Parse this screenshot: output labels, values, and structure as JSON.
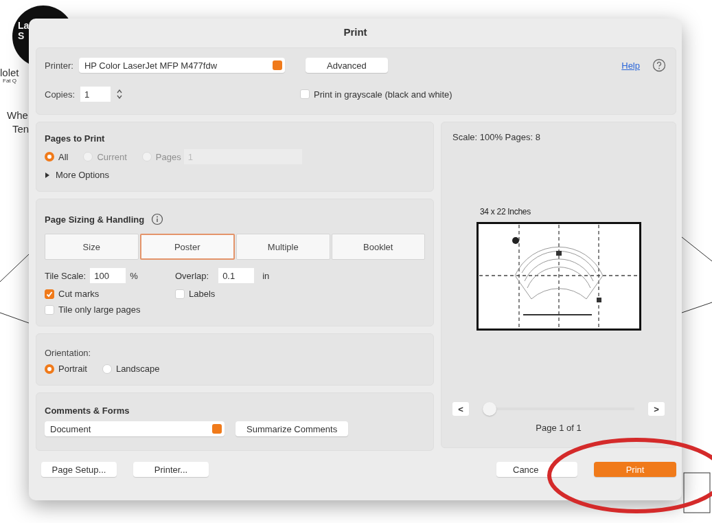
{
  "background": {
    "logo_lines": [
      "La",
      "S"
    ],
    "fragments": [
      "lolet",
      "Fat Q",
      "Whe",
      "Ten"
    ]
  },
  "window": {
    "title": "Print"
  },
  "printer": {
    "label": "Printer:",
    "value": "HP Color LaserJet MFP M477fdw",
    "advanced_button": "Advanced",
    "help_link": "Help"
  },
  "copies": {
    "label": "Copies:",
    "value": "1"
  },
  "grayscale": {
    "label": "Print in grayscale (black and white)",
    "checked": false
  },
  "pages_to_print": {
    "title": "Pages to Print",
    "options": [
      {
        "label": "All",
        "selected": true,
        "disabled": false
      },
      {
        "label": "Current",
        "selected": false,
        "disabled": true
      },
      {
        "label": "Pages",
        "selected": false,
        "disabled": true
      }
    ],
    "pages_value": "1",
    "more_options": {
      "label": "More Options",
      "expanded": false
    }
  },
  "page_sizing": {
    "title": "Page Sizing & Handling",
    "modes": [
      {
        "label": "Size",
        "selected": false
      },
      {
        "label": "Poster",
        "selected": true
      },
      {
        "label": "Multiple",
        "selected": false
      },
      {
        "label": "Booklet",
        "selected": false
      }
    ],
    "tile_scale": {
      "label": "Tile Scale:",
      "value": "100",
      "unit": "%"
    },
    "overlap": {
      "label": "Overlap:",
      "value": "0.1",
      "unit": "in"
    },
    "checkboxes": [
      {
        "label": "Cut marks",
        "checked": true
      },
      {
        "label": "Labels",
        "checked": false
      },
      {
        "label": "Tile only large pages",
        "checked": false
      }
    ]
  },
  "orientation": {
    "title": "Orientation:",
    "options": [
      {
        "label": "Portrait",
        "selected": true
      },
      {
        "label": "Landscape",
        "selected": false
      }
    ]
  },
  "comments_forms": {
    "title": "Comments & Forms",
    "value": "Document",
    "button": "Summarize Comments"
  },
  "preview": {
    "summary": "Scale: 100% Pages: 8",
    "paper_size": "34 x 22 Inches",
    "prev": "<",
    "next": ">",
    "slider": {
      "level": 0
    },
    "page_label": "Page 1 of 1"
  },
  "footer": {
    "left_buttons": [
      "Page Setup...",
      "Printer..."
    ],
    "cancel": "Cance",
    "print": "Print"
  }
}
